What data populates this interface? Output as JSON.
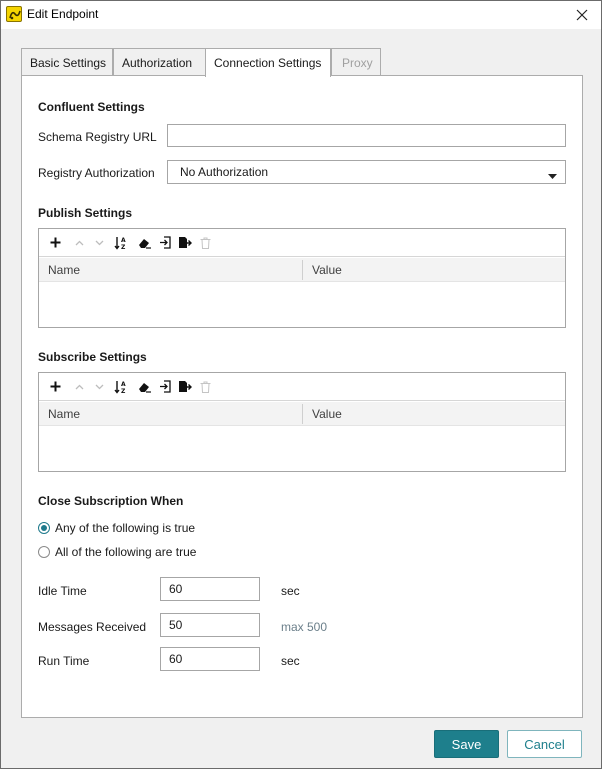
{
  "window": {
    "title": "Edit Endpoint"
  },
  "tabs": [
    {
      "label": "Basic Settings"
    },
    {
      "label": "Authorization"
    },
    {
      "label": "Connection Settings"
    },
    {
      "label": "Proxy"
    }
  ],
  "confluent": {
    "title": "Confluent Settings",
    "schema_registry_label": "Schema Registry URL",
    "schema_registry_value": "",
    "registry_auth_label": "Registry Authorization",
    "registry_auth_value": "No Authorization"
  },
  "publish": {
    "title": "Publish Settings",
    "columns": [
      "Name",
      "Value"
    ]
  },
  "subscribe": {
    "title": "Subscribe Settings",
    "columns": [
      "Name",
      "Value"
    ]
  },
  "close_sub": {
    "title": "Close Subscription When",
    "option_any": "Any of the following is true",
    "option_all": "All of the following are true",
    "idle_label": "Idle Time",
    "idle_value": "60",
    "idle_unit": "sec",
    "messages_label": "Messages Received",
    "messages_value": "50",
    "messages_hint": "max 500",
    "run_label": "Run Time",
    "run_value": "60",
    "run_unit": "sec"
  },
  "buttons": {
    "save": "Save",
    "cancel": "Cancel"
  },
  "colors": {
    "accent": "#1e7f8c",
    "disabled_text": "#a0a0a0"
  }
}
